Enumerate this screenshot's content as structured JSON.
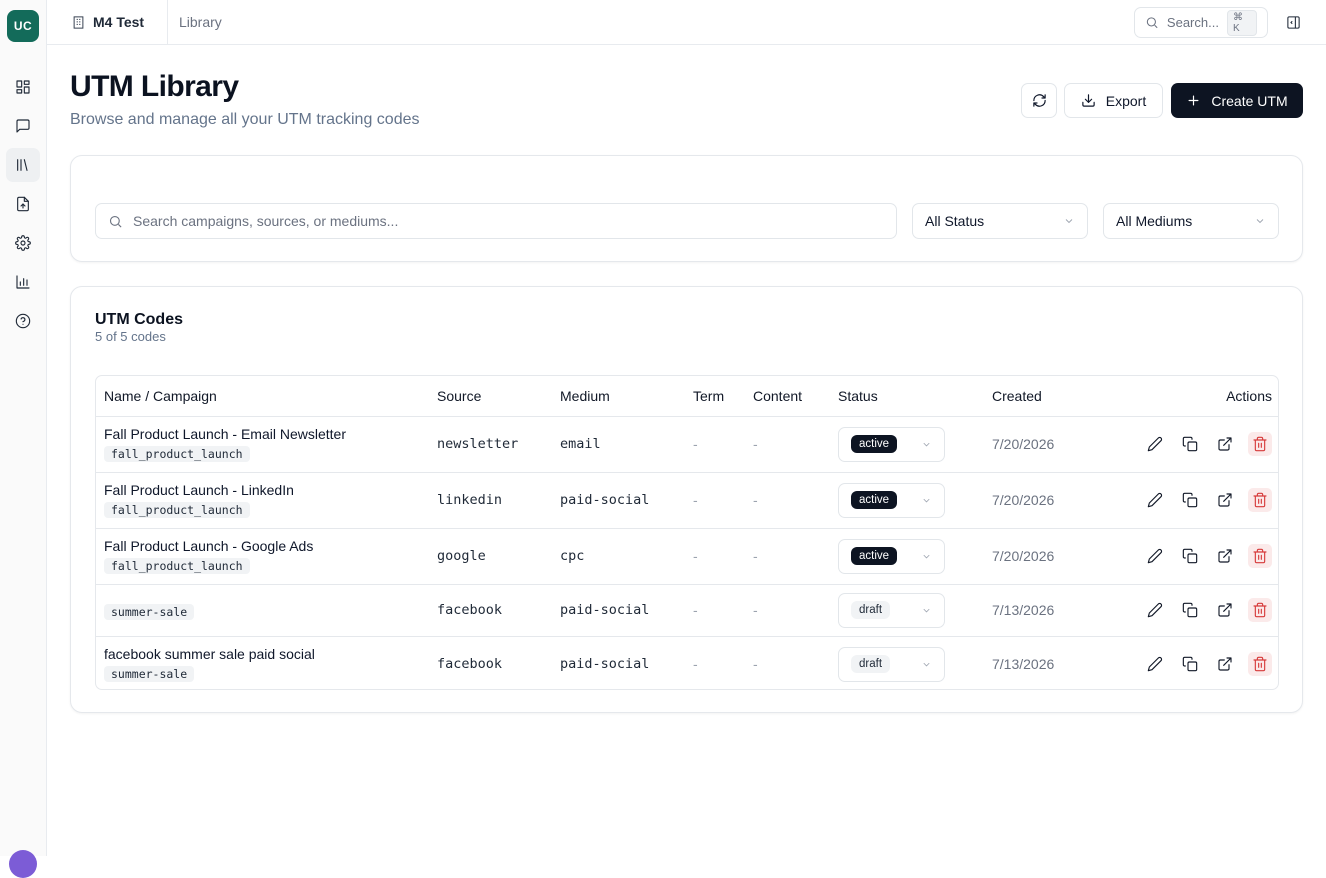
{
  "app": {
    "logo_text": "UC",
    "project_name": "M4 Test",
    "current_page": "Library"
  },
  "topbar": {
    "search_label": "Search...",
    "search_shortcut": "⌘ K"
  },
  "sidebar": {
    "items": [
      {
        "name": "dashboard",
        "icon": "grid-icon",
        "active": false
      },
      {
        "name": "messages",
        "icon": "chat-icon",
        "active": false
      },
      {
        "name": "library",
        "icon": "library-icon",
        "active": true
      },
      {
        "name": "import",
        "icon": "file-upload-icon",
        "active": false
      },
      {
        "name": "settings",
        "icon": "gear-icon",
        "active": false
      },
      {
        "name": "analytics",
        "icon": "bar-chart-icon",
        "active": false
      },
      {
        "name": "help",
        "icon": "help-icon",
        "active": false
      }
    ]
  },
  "header": {
    "title": "UTM Library",
    "subtitle": "Browse and manage all your UTM tracking codes",
    "export_label": "Export",
    "create_label": "Create UTM"
  },
  "filters": {
    "search_placeholder": "Search campaigns, sources, or mediums...",
    "status_value": "All Status",
    "medium_value": "All Mediums"
  },
  "codes": {
    "title": "UTM Codes",
    "count_text": "5 of 5 codes",
    "columns": [
      "Name / Campaign",
      "Source",
      "Medium",
      "Term",
      "Content",
      "Status",
      "Created",
      "Actions"
    ],
    "rows": [
      {
        "name": "Fall Product Launch - Email Newsletter",
        "campaign": "fall_product_launch",
        "source": "newsletter",
        "medium": "email",
        "term": "-",
        "content": "-",
        "status": "active",
        "created": "7/20/2026"
      },
      {
        "name": "Fall Product Launch - LinkedIn",
        "campaign": "fall_product_launch",
        "source": "linkedin",
        "medium": "paid-social",
        "term": "-",
        "content": "-",
        "status": "active",
        "created": "7/20/2026"
      },
      {
        "name": "Fall Product Launch - Google Ads",
        "campaign": "fall_product_launch",
        "source": "google",
        "medium": "cpc",
        "term": "-",
        "content": "-",
        "status": "active",
        "created": "7/20/2026"
      },
      {
        "name": "",
        "campaign": "summer-sale",
        "source": "facebook",
        "medium": "paid-social",
        "term": "-",
        "content": "-",
        "status": "draft",
        "created": "7/13/2026"
      },
      {
        "name": "facebook summer sale paid social",
        "campaign": "summer-sale",
        "source": "facebook",
        "medium": "paid-social",
        "term": "-",
        "content": "-",
        "status": "draft",
        "created": "7/13/2026"
      }
    ]
  },
  "colors": {
    "brand": "#136b5a",
    "primary_button": "#0d1422",
    "delete": "#d63a3a"
  }
}
